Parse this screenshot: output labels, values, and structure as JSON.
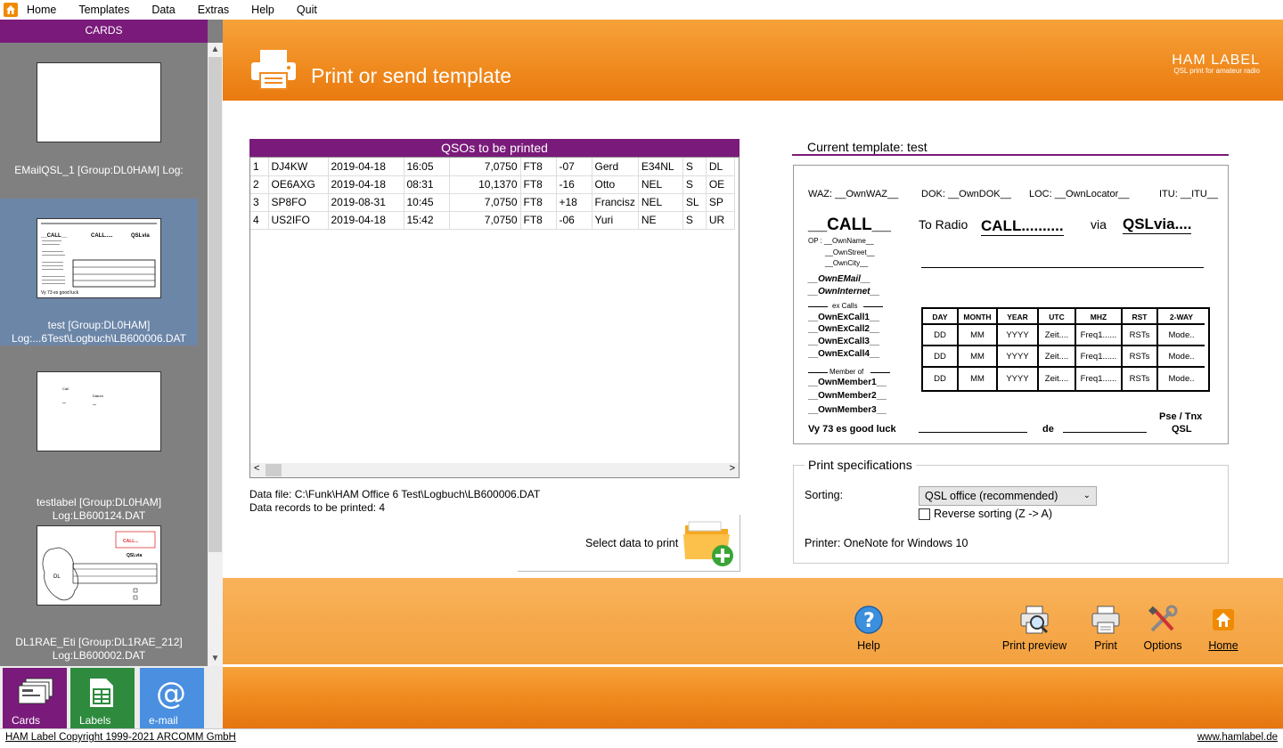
{
  "menubar": {
    "items": [
      "Home",
      "Templates",
      "Data",
      "Extras",
      "Help",
      "Quit"
    ]
  },
  "sidebar": {
    "header": "CARDS",
    "cards": [
      {
        "caption_line1": "EMailQSL_1 [Group:DL0HAM] Log:",
        "caption_line2": ""
      },
      {
        "caption_line1": "test [Group:DL0HAM]",
        "caption_line2": "Log:...6Test\\Logbuch\\LB600006.DAT"
      },
      {
        "caption_line1": "testlabel [Group:DL0HAM]",
        "caption_line2": "Log:LB600124.DAT"
      },
      {
        "caption_line1": "DL1RAE_Eti [Group:DL1RAE_212]",
        "caption_line2": "Log:LB600002.DAT"
      }
    ],
    "tabs": [
      {
        "label": "Cards",
        "color": "#7a1a7a"
      },
      {
        "label": "Labels",
        "color": "#2e8b3e"
      },
      {
        "label": "e-mail",
        "color": "#4a8fe0"
      }
    ]
  },
  "banner": {
    "title": "Print or send template",
    "brand": "HAM LABEL",
    "brand_sub": "QSL print for amateur radio"
  },
  "qso": {
    "header": "QSOs to be printed",
    "rows": [
      [
        "1",
        "DJ4KW",
        "2019-04-18",
        "16:05",
        "7,0750",
        "FT8",
        "-07",
        "Gerd",
        "E34NL",
        "S",
        "DL"
      ],
      [
        "2",
        "OE6AXG",
        "2019-04-18",
        "08:31",
        "10,1370",
        "FT8",
        "-16",
        "Otto",
        "NEL",
        "S",
        "OE"
      ],
      [
        "3",
        "SP8FO",
        "2019-08-31",
        "10:45",
        "7,0750",
        "FT8",
        "+18",
        "Francisz",
        "NEL",
        "SL",
        "SP"
      ],
      [
        "4",
        "US2IFO",
        "2019-04-18",
        "15:42",
        "7,0750",
        "FT8",
        "-06",
        "Yuri",
        "NE",
        "S",
        "UR"
      ]
    ]
  },
  "datafile": {
    "file": "Data file: C:\\Funk\\HAM Office 6 Test\\Logbuch\\LB600006.DAT",
    "records": "Data records to be printed: 4"
  },
  "select_data": {
    "label": "Select data to print"
  },
  "template": {
    "header": "Current template: test",
    "waz": "WAZ:  __OwnWAZ__",
    "dok": "DOK:  __OwnDOK__",
    "loc": "LOC:  __OwnLocator__",
    "itu": "ITU:  __ITU__",
    "call": "__CALL__",
    "to_radio": "To Radio",
    "call2": "CALL..........",
    "via": "via",
    "qslvia": "QSLvia....",
    "op": "OP : __OwnName__",
    "street": "__OwnStreet__",
    "city": "__OwnCity__",
    "email": "__OwnEMail__",
    "internet": "__OwnInternet__",
    "excalls": "ex Calls",
    "ex1": "__OwnExCall1__",
    "ex2": "__OwnExCall2__",
    "ex3": "__OwnExCall3__",
    "ex4": "__OwnExCall4__",
    "member_of": "Member of",
    "m1": "__OwnMember1__",
    "m2": "__OwnMember2__",
    "m3": "__OwnMember3__",
    "vy73": "Vy 73 es good luck",
    "de": "de",
    "pse": "Pse / Tnx",
    "qsl": "QSL",
    "grid_headers": [
      "DAY",
      "MONTH",
      "YEAR",
      "UTC",
      "MHZ",
      "RST",
      "2-WAY"
    ],
    "grid_row": [
      "DD",
      "MM",
      "YYYY",
      "Zeit....",
      "Freq1......",
      "RSTs",
      "Mode.."
    ]
  },
  "specs": {
    "legend": "Print specifications",
    "sorting_label": "Sorting:",
    "sorting_value": "QSL office (recommended)",
    "reverse_label": "Reverse sorting (Z -> A)",
    "printer": "Printer: OneNote for Windows 10"
  },
  "toolbar": {
    "help": "Help",
    "print_preview": "Print preview",
    "print": "Print",
    "options": "Options",
    "home": "Home"
  },
  "status": {
    "copyright": "HAM Label Copyright 1999-2021 ARCOMM GmbH",
    "url": "www.hamlabel.de"
  }
}
